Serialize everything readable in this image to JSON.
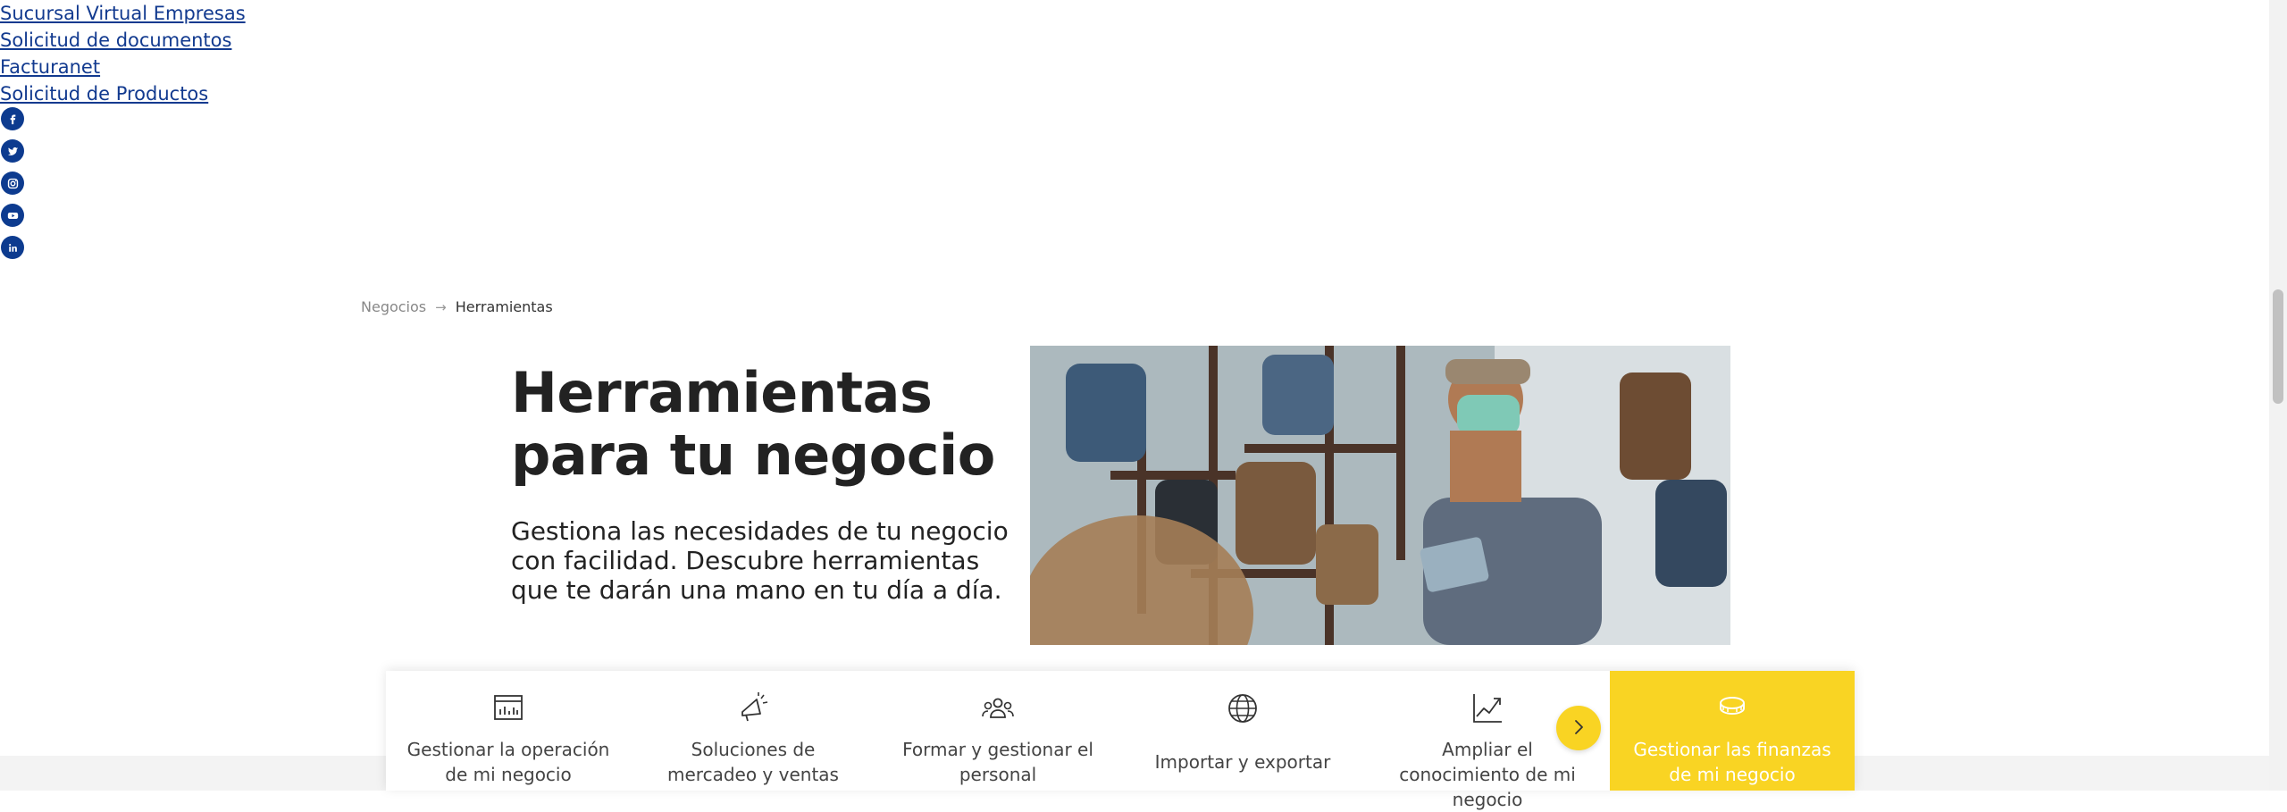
{
  "top_links": [
    {
      "label": "Sucursal Virtual Empresas"
    },
    {
      "label": "Solicitud de documentos"
    },
    {
      "label": "Facturanet"
    },
    {
      "label": "Solicitud de Productos"
    }
  ],
  "social": [
    {
      "icon": "facebook-icon"
    },
    {
      "icon": "twitter-icon"
    },
    {
      "icon": "instagram-icon"
    },
    {
      "icon": "youtube-icon"
    },
    {
      "icon": "linkedin-icon"
    }
  ],
  "breadcrumb": {
    "items": [
      "Negocios",
      "Herramientas"
    ],
    "separator_icon": "arrow-right-icon"
  },
  "hero": {
    "title_line1": "Herramientas",
    "title_line2": "para tu negocio",
    "subtitle": "Gestiona las necesidades de tu negocio con facilidad. Descubre herramientas que te darán una mano en tu día a día."
  },
  "tools": [
    {
      "label": "Gestionar la operación de mi negocio",
      "icon": "dashboard-icon"
    },
    {
      "label": "Soluciones de mercadeo y ventas",
      "icon": "megaphone-icon"
    },
    {
      "label": "Formar y gestionar el personal",
      "icon": "team-icon"
    },
    {
      "label": "Importar y exportar",
      "icon": "globe-icon"
    },
    {
      "label": "Ampliar el conocimiento de mi negocio",
      "icon": "growth-chart-icon"
    },
    {
      "label": "Gestionar las finanzas de mi negocio",
      "icon": "coins-icon",
      "active": true
    }
  ],
  "next_button": {
    "icon": "chevron-right-icon"
  },
  "colors": {
    "accent": "#f9d423",
    "link": "#123a8f",
    "social": "#0d3b8f"
  }
}
